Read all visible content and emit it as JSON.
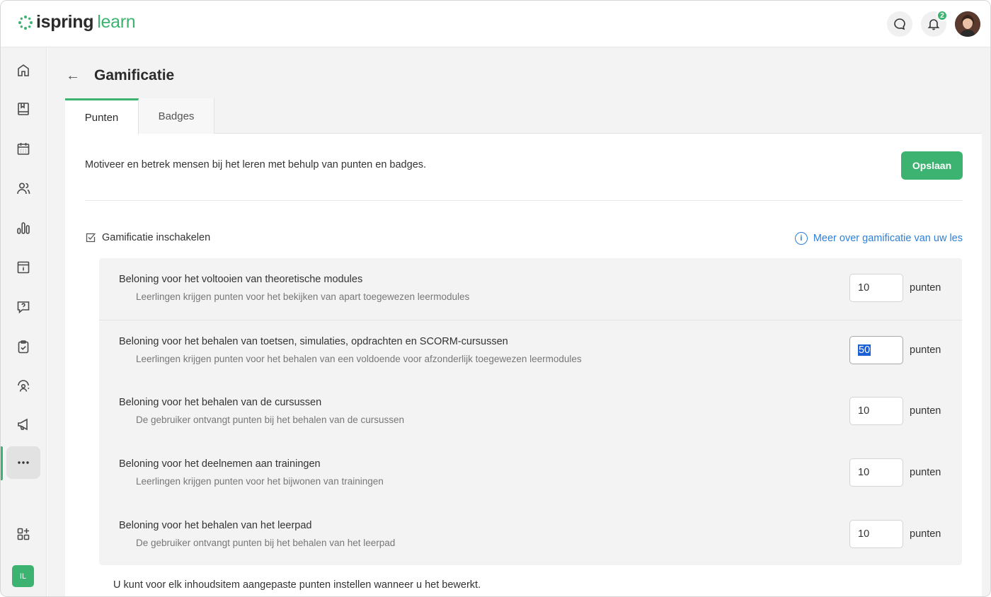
{
  "app": {
    "logo_primary": "ispring",
    "logo_secondary": "learn",
    "notification_count": "2",
    "user_initials": "IL"
  },
  "colors": {
    "accent": "#3cb371",
    "link": "#2f7fd6",
    "selection": "#1a5fd6"
  },
  "sidebar": {
    "items": [
      {
        "name": "home-icon"
      },
      {
        "name": "book-icon"
      },
      {
        "name": "calendar-icon"
      },
      {
        "name": "users-icon"
      },
      {
        "name": "reports-icon"
      },
      {
        "name": "info-box-icon"
      },
      {
        "name": "question-chat-icon"
      },
      {
        "name": "clipboard-icon"
      },
      {
        "name": "coach-icon"
      },
      {
        "name": "megaphone-icon"
      },
      {
        "name": "more-icon"
      },
      {
        "name": "add-apps-icon"
      }
    ]
  },
  "page": {
    "title": "Gamificatie",
    "tabs": [
      "Punten",
      "Badges"
    ],
    "intro": "Motiveer en betrek mensen bij het leren met behulp van punten en badges.",
    "save_label": "Opslaan",
    "enable_label": "Gamificatie inschakelen",
    "enable_checked": true,
    "info_link": "Meer over gamificatie van uw les",
    "footer_note": "U kunt voor elk inhoudsitem aangepaste punten instellen wanneer u het bewerkt."
  },
  "rewards": [
    {
      "title": "Beloning voor het voltooien van theoretische modules",
      "description": "Leerlingen krijgen punten voor het bekijken van apart toegewezen leermodules",
      "value": "10",
      "unit": "punten"
    },
    {
      "title": "Beloning voor het behalen van toetsen, simulaties, opdrachten en SCORM-cursussen",
      "description": "Leerlingen krijgen punten voor het behalen van een voldoende voor afzonderlijk toegewezen leermodules",
      "value": "50",
      "unit": "punten",
      "selected": true
    },
    {
      "title": "Beloning voor het behalen van de cursussen",
      "description": "De gebruiker ontvangt punten bij het behalen van de cursussen",
      "value": "10",
      "unit": "punten"
    },
    {
      "title": "Beloning voor het deelnemen aan trainingen",
      "description": "Leerlingen krijgen punten voor het bijwonen van trainingen",
      "value": "10",
      "unit": "punten"
    },
    {
      "title": "Beloning voor het behalen van het leerpad",
      "description": "De gebruiker ontvangt punten bij het behalen van het leerpad",
      "value": "10",
      "unit": "punten"
    }
  ]
}
